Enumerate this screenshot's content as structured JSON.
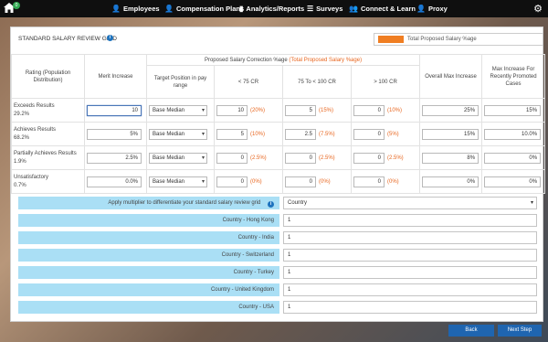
{
  "topbar": {
    "notification_count": "0",
    "nav": [
      {
        "label": "Employees",
        "icon": "person-icon"
      },
      {
        "label": "Compensation Plans",
        "icon": "person-icon"
      },
      {
        "label": "Analytics/Reports",
        "icon": "bar-chart-icon"
      },
      {
        "label": "Surveys",
        "icon": "list-icon"
      },
      {
        "label": "Connect & Learn",
        "icon": "people-icon"
      },
      {
        "label": "Proxy",
        "icon": "person-icon"
      }
    ]
  },
  "panel": {
    "title": "STANDARD SALARY REVIEW GRID",
    "legend_label": "Total Proposed Salary %age",
    "legend_color": "#f07e22"
  },
  "grid": {
    "headers": {
      "rating": "Rating (Population Distribution)",
      "merit": "Merit Increase",
      "correction_prefix": "Proposed Salary Correction %age",
      "correction_suffix": "(Total Proposed Salary %age)",
      "target": "Target Position in pay range",
      "lt75": "< 75 CR",
      "mid": "75 To < 100 CR",
      "gt100": "> 100 CR",
      "overall": "Overall Max Increase",
      "promoted": "Max Increase For Recently Promoted Cases"
    },
    "rows": [
      {
        "rating": "Exceeds Results",
        "dist": "29.2%",
        "merit": "10",
        "target": "Base Median",
        "lt75": "10",
        "lt75_total": "(20%)",
        "mid": "5",
        "mid_total": "(15%)",
        "gt100": "0",
        "gt100_total": "(10%)",
        "overall": "25%",
        "promoted": "15%"
      },
      {
        "rating": "Achieves Results",
        "dist": "68.2%",
        "merit": "5%",
        "target": "Base Median",
        "lt75": "5",
        "lt75_total": "(10%)",
        "mid": "2.5",
        "mid_total": "(7.5%)",
        "gt100": "0",
        "gt100_total": "(5%)",
        "overall": "15%",
        "promoted": "10.0%"
      },
      {
        "rating": "Partially Achieves Results",
        "dist": "1.9%",
        "merit": "2.5%",
        "target": "Base Median",
        "lt75": "0",
        "lt75_total": "(2.5%)",
        "mid": "0",
        "mid_total": "(2.5%)",
        "gt100": "0",
        "gt100_total": "(2.5%)",
        "overall": "8%",
        "promoted": "0%"
      },
      {
        "rating": "Unsatisfactory",
        "dist": "0.7%",
        "merit": "0.0%",
        "target": "Base Median",
        "lt75": "0",
        "lt75_total": "(0%)",
        "mid": "0",
        "mid_total": "(0%)",
        "gt100": "0",
        "gt100_total": "(0%)",
        "overall": "0%",
        "promoted": "0%"
      }
    ]
  },
  "multiplier": {
    "label": "Apply multiplier to differentiate your standard salary review grid",
    "selected": "Country",
    "rows": [
      {
        "label": "Country - Hong Kong",
        "value": "1"
      },
      {
        "label": "Country - India",
        "value": "1"
      },
      {
        "label": "Country - Switzerland",
        "value": "1"
      },
      {
        "label": "Country - Turkey",
        "value": "1"
      },
      {
        "label": "Country - United Kingdom",
        "value": "1"
      },
      {
        "label": "Country - USA",
        "value": "1"
      }
    ]
  },
  "buttons": {
    "back": "Back",
    "next": "Next Step"
  }
}
